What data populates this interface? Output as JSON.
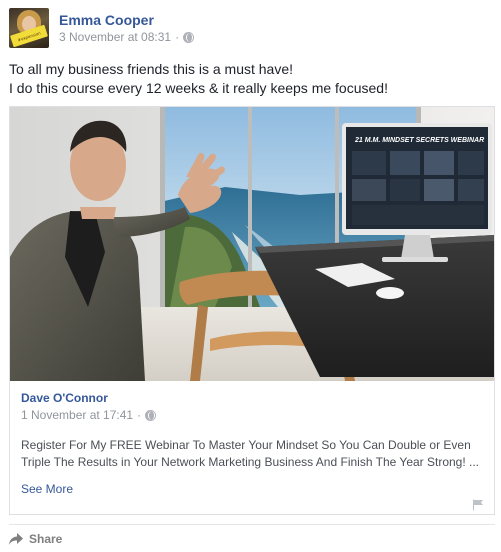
{
  "post": {
    "author": "Emma Cooper",
    "timestamp": "3 November at 08:31",
    "separator": "·",
    "privacy_icon": "globe-icon",
    "avatar_sign_text": "#expansion",
    "text_line1": "To all my business friends this is a must have!",
    "text_line2": "I do this course every 12 weeks & it really keeps me focused!"
  },
  "shared": {
    "image_caption": "21 M.M. MINDSET SECRETS WEBINAR",
    "author": "Dave O'Connor",
    "timestamp": "1 November at 17:41",
    "separator": "·",
    "description": "Register For My FREE Webinar To Master Your Mindset So You Can Double or Even Triple The Results in Your Network Marketing Business And Finish The Year Strong! ...",
    "see_more": "See More",
    "flag_icon": "flag-icon"
  },
  "actions": {
    "share_label": "Share",
    "share_icon": "share-arrow-icon"
  },
  "colors": {
    "link_blue": "#365899",
    "meta_gray": "#90949c",
    "text": "#1d2129",
    "border": "#dddfe2"
  }
}
